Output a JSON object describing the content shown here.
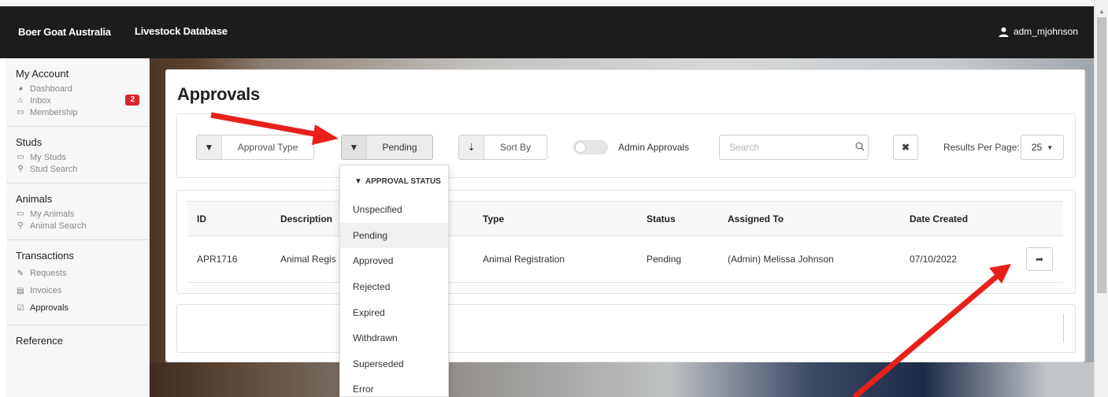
{
  "header": {
    "brand": "Boer Goat Australia",
    "section": "Livestock Database",
    "username": "adm_mjohnson"
  },
  "sidebar": {
    "groups": [
      {
        "title": "My Account",
        "items": [
          {
            "label": "Dashboard",
            "icon": "dashboard-icon"
          },
          {
            "label": "Inbox",
            "icon": "inbox-icon",
            "badge": "2"
          },
          {
            "label": "Membership",
            "icon": "id-card-icon"
          }
        ]
      },
      {
        "title": "Studs",
        "items": [
          {
            "label": "My Studs",
            "icon": "folder-icon"
          },
          {
            "label": "Stud Search",
            "icon": "search-icon"
          }
        ]
      },
      {
        "title": "Animals",
        "items": [
          {
            "label": "My Animals",
            "icon": "folder-icon"
          },
          {
            "label": "Animal Search",
            "icon": "search-icon"
          }
        ]
      },
      {
        "title": "Transactions",
        "items": [
          {
            "label": "Requests",
            "icon": "pencil-icon"
          },
          {
            "label": "Invoices",
            "icon": "invoice-icon"
          },
          {
            "label": "Approvals",
            "icon": "checkbox-icon",
            "active": true
          }
        ]
      },
      {
        "title": "Reference",
        "items": []
      }
    ]
  },
  "page": {
    "title": "Approvals"
  },
  "filters": {
    "approval_type": "Approval Type",
    "status": "Pending",
    "sort_by": "Sort By",
    "admin_toggle_label": "Admin Approvals",
    "search_placeholder": "Search",
    "results_per_page_label": "Results Per Page:",
    "results_per_page_value": "25"
  },
  "table": {
    "columns": [
      "ID",
      "Description",
      "Type",
      "Status",
      "Assigned To",
      "Date Created"
    ],
    "rows": [
      {
        "id": "APR1716",
        "description": "Animal Regis",
        "type": "Animal Registration",
        "status": "Pending",
        "assigned_to": "(Admin) Melissa Johnson",
        "date_created": "07/10/2022"
      }
    ]
  },
  "status_dropdown": {
    "header": "APPROVAL STATUS",
    "options": [
      "Unspecified",
      "Pending",
      "Approved",
      "Rejected",
      "Expired",
      "Withdrawn",
      "Superseded",
      "Error"
    ],
    "selected": "Pending"
  },
  "colors": {
    "topbar": "#1c1c1c",
    "badge": "#d9262e",
    "annotation_arrow": "#e8201a"
  }
}
